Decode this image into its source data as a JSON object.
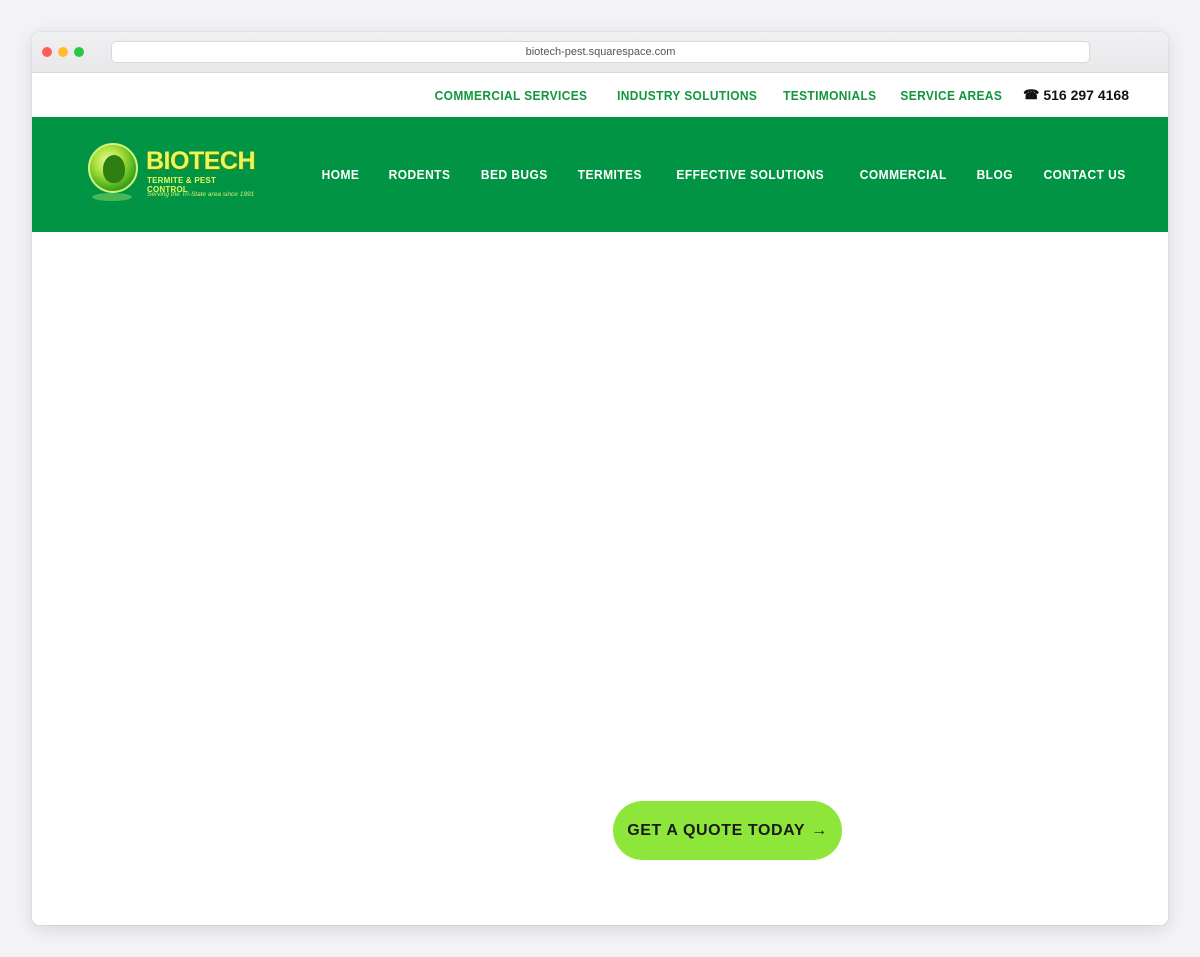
{
  "browser": {
    "url": "biotech-pest.squarespace.com"
  },
  "topnav": {
    "items": [
      "COMMERCIAL SERVICES",
      "INDUSTRY SOLUTIONS",
      "TESTIMONIALS",
      "SERVICE AREAS"
    ],
    "phone": "516 297 4168",
    "phone_icon": "phone-icon"
  },
  "logo": {
    "name": "BIOTECH",
    "subtitle": "TERMITE & PEST CONTROL",
    "tagline": "Serving the Tri-State area since 1991"
  },
  "mainnav": {
    "items": [
      "HOME",
      "RODENTS",
      "BED BUGS",
      "TERMITES",
      "EFFECTIVE SOLUTIONS",
      "COMMERCIAL",
      "BLOG",
      "CONTACT US"
    ]
  },
  "cta": {
    "label": "GET A QUOTE TODAY",
    "arrow": "→"
  },
  "colors": {
    "brand_green": "#009444",
    "link_green": "#12953d",
    "cta_green": "#8ee63a",
    "logo_yellow": "#e9f75d"
  }
}
